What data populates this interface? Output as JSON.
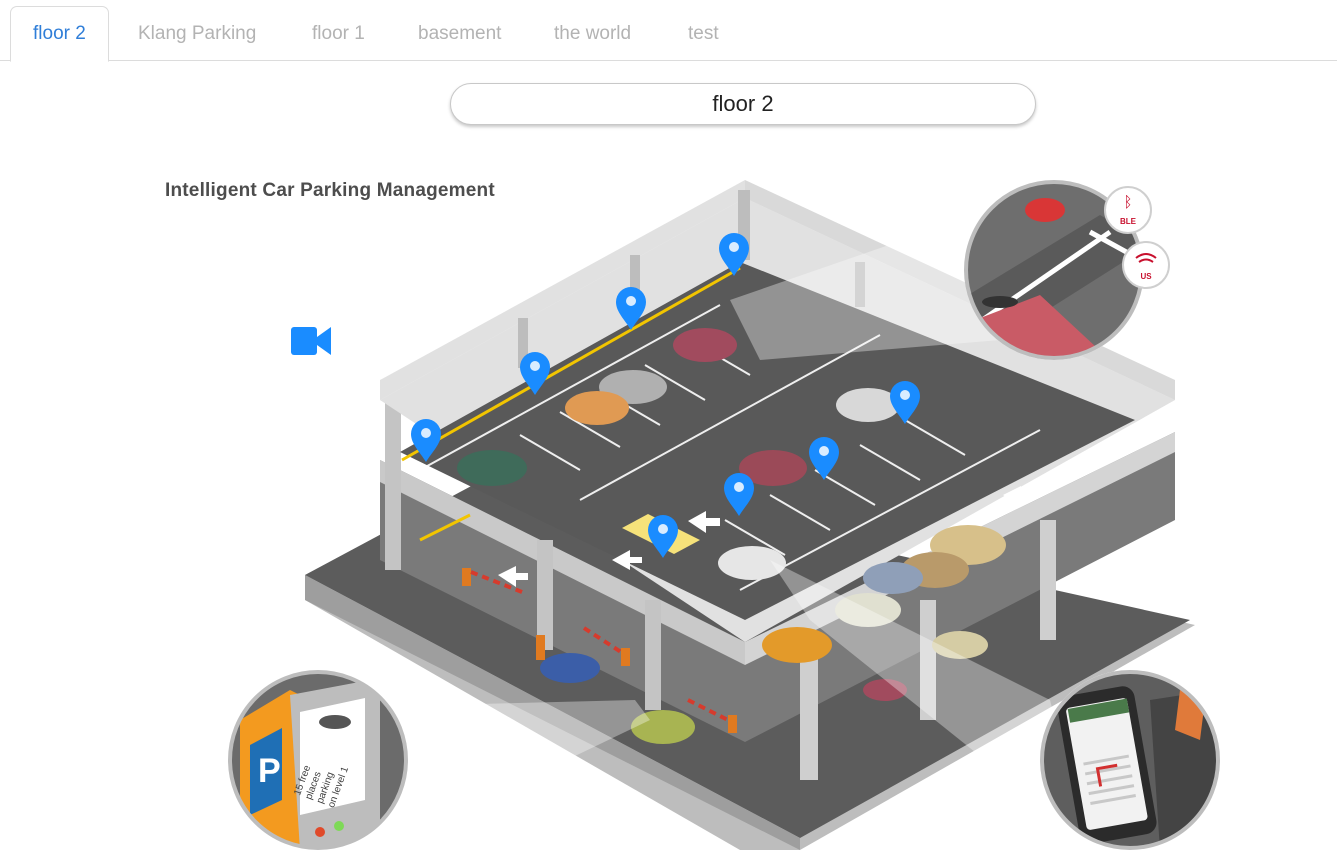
{
  "tabs": [
    {
      "label": "floor 2",
      "active": true
    },
    {
      "label": "Klang Parking",
      "active": false
    },
    {
      "label": "floor 1",
      "active": false
    },
    {
      "label": "basement",
      "active": false
    },
    {
      "label": "the world",
      "active": false
    },
    {
      "label": "test",
      "active": false
    }
  ],
  "floor_title": "floor 2",
  "map": {
    "title": "Intelligent Car Parking Management",
    "sensor_badges": [
      "BLE",
      "US"
    ],
    "kiosk_text": [
      "15 free",
      "places",
      "parking",
      "on level 1"
    ],
    "kiosk_sign": "P"
  },
  "colors": {
    "accent": "#2f7ed8",
    "marker": "#1a8cff",
    "tab_inactive": "#b3b3b3",
    "badge_red": "#c8102e"
  },
  "icons": {
    "camera": "video-camera-icon",
    "marker": "map-marker-icon"
  }
}
